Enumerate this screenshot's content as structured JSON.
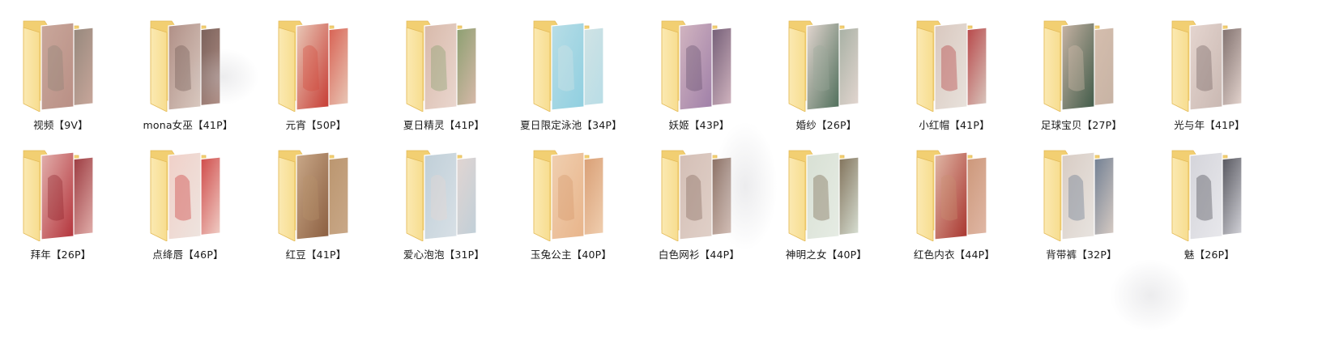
{
  "folders": [
    {
      "name": "视频【9V】",
      "photo1": "#b98f85",
      "photo2": "#8a8176",
      "accent": "#c9a79b"
    },
    {
      "name": "mona女巫【41P】",
      "photo1": "#d9c9c0",
      "photo2": "#6e5650",
      "accent": "#b08f86"
    },
    {
      "name": "元宵【50P】",
      "photo1": "#c63a32",
      "photo2": "#d44a3c",
      "accent": "#e9c9b8"
    },
    {
      "name": "夏日精灵【41P】",
      "photo1": "#ead7cf",
      "photo2": "#7b9a64",
      "accent": "#d8b9aa"
    },
    {
      "name": "夏日限定泳池【34P】",
      "photo1": "#8fcfe0",
      "photo2": "#d6e4e4",
      "accent": "#b8dde6"
    },
    {
      "name": "妖姬【43P】",
      "photo1": "#9f7fa8",
      "photo2": "#5e4a66",
      "accent": "#d2b5c0"
    },
    {
      "name": "婚纱【26P】",
      "photo1": "#4e6e5a",
      "photo2": "#9aa89a",
      "accent": "#e3d6d0"
    },
    {
      "name": "小红帽【41P】",
      "photo1": "#e8e2dc",
      "photo2": "#b02a2e",
      "accent": "#d9c8bf"
    },
    {
      "name": "足球宝贝【27P】",
      "photo1": "#3f5a48",
      "photo2": "#d8c0b0",
      "accent": "#c7b3a4"
    },
    {
      "name": "光与年【41P】",
      "photo1": "#c9b8b2",
      "photo2": "#6a5a58",
      "accent": "#e5d5cf"
    },
    {
      "name": "拜年【26P】",
      "photo1": "#b3323a",
      "photo2": "#8c2028",
      "accent": "#e2b0ac"
    },
    {
      "name": "点绛唇【46P】",
      "photo1": "#eee4df",
      "photo2": "#c82c2c",
      "accent": "#f0d0c8"
    },
    {
      "name": "红豆【41P】",
      "photo1": "#8b5e40",
      "photo2": "#b8926a",
      "accent": "#c9a888"
    },
    {
      "name": "爱心泡泡【31P】",
      "photo1": "#d8e0e6",
      "photo2": "#e9d6d0",
      "accent": "#c0cfd8"
    },
    {
      "name": "玉兔公主【40P】",
      "photo1": "#e8b48a",
      "photo2": "#d49468",
      "accent": "#f0cfb0"
    },
    {
      "name": "白色网衫【44P】",
      "photo1": "#e0d0c8",
      "photo2": "#7a5e52",
      "accent": "#d4bfb6"
    },
    {
      "name": "神明之女【40P】",
      "photo1": "#e6ece4",
      "photo2": "#6e5a40",
      "accent": "#d8e0d4"
    },
    {
      "name": "红色内衣【44P】",
      "photo1": "#a8342e",
      "photo2": "#c89070",
      "accent": "#e0b8a6"
    },
    {
      "name": "背带裤【32P】",
      "photo1": "#e8e4e0",
      "photo2": "#5a6e88",
      "accent": "#d8ccc4"
    },
    {
      "name": "魅【26P】",
      "photo1": "#e8e8ec",
      "photo2": "#3a3a42",
      "accent": "#d4d4da"
    }
  ],
  "colors": {
    "folder_back": "#f2cf72",
    "folder_front": "#f7dd8f",
    "folder_edge": "#e4bb58",
    "folder_highlight": "#fbe9b2",
    "label_text": "#1a1a1a",
    "background": "#ffffff"
  },
  "icons": {
    "folder": "folder-icon"
  }
}
